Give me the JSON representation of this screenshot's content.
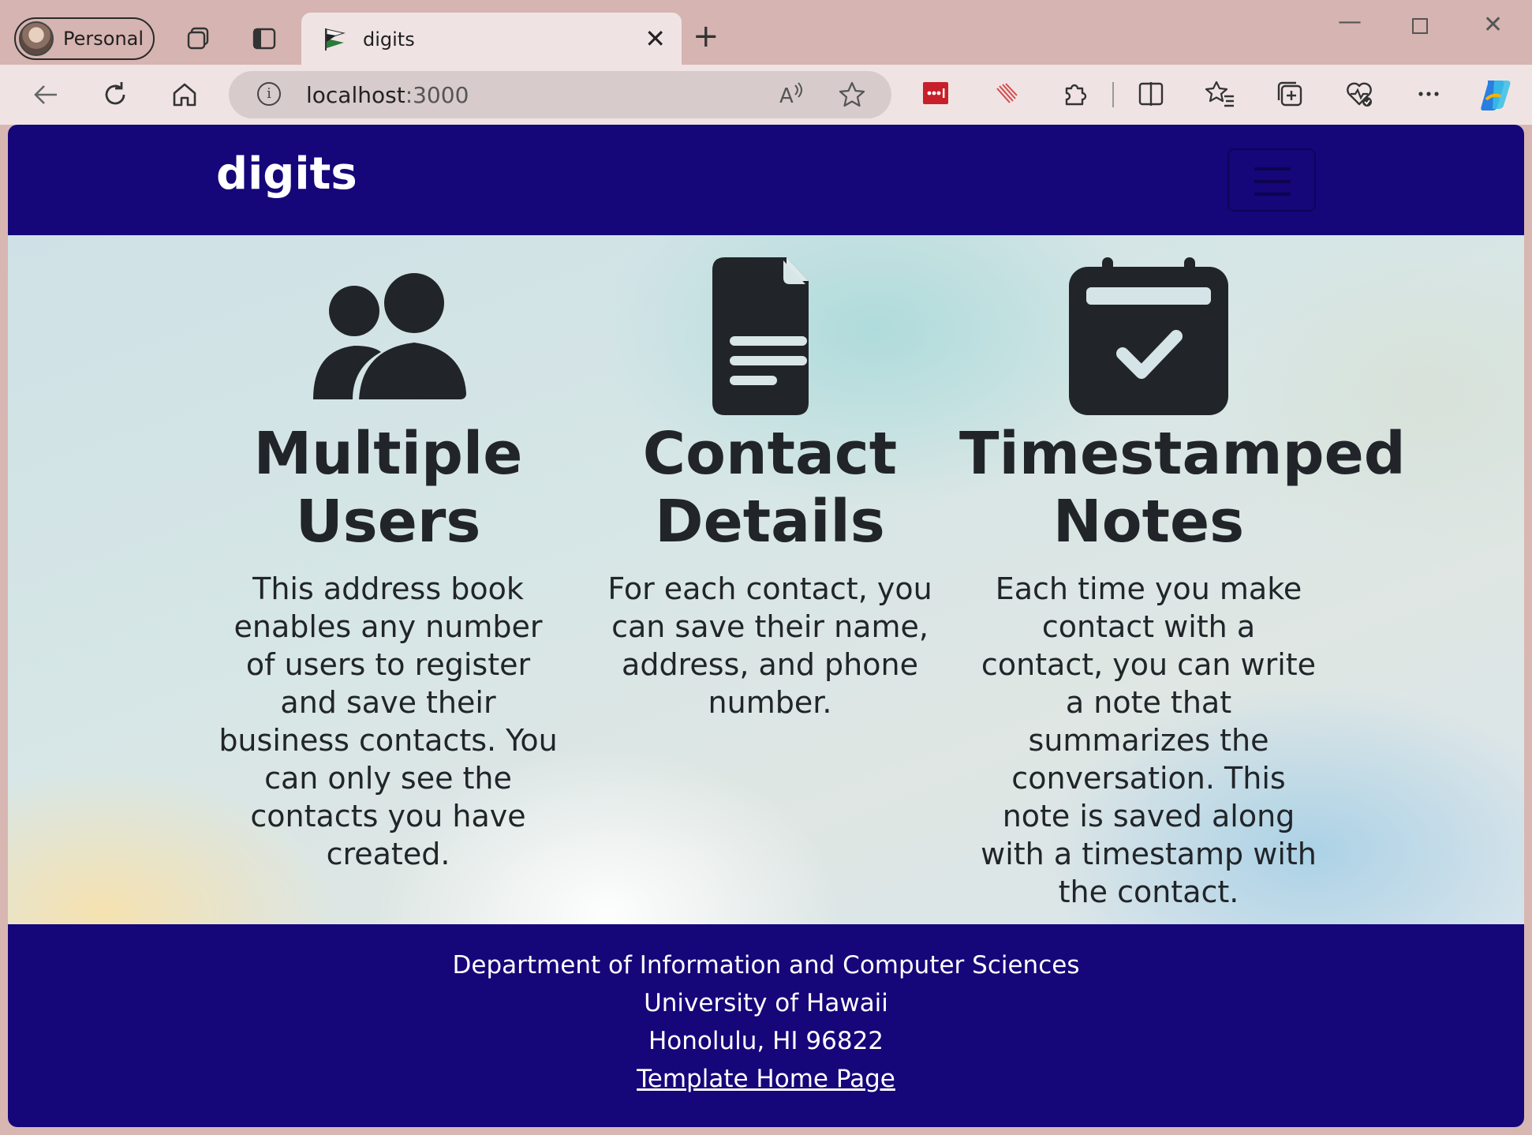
{
  "browser": {
    "profile_label": "Personal",
    "tab_title": "digits",
    "url_host": "localhost",
    "url_port": ":3000",
    "icons": [
      "workspaces-icon",
      "tab-actions-icon",
      "close-icon",
      "new-tab-icon",
      "back-icon",
      "refresh-icon",
      "home-icon",
      "info-icon",
      "read-aloud-icon",
      "favorite-star-icon",
      "lastpass-icon",
      "extension-icon",
      "puzzle-icon",
      "split-screen-icon",
      "favorites-icon",
      "collections-icon",
      "browser-essentials-icon",
      "more-icon",
      "copilot-icon"
    ]
  },
  "navbar": {
    "brand": "digits"
  },
  "features": [
    {
      "icon": "users-icon",
      "title_line1": "Multiple",
      "title_line2": "Users",
      "text": "This address book enables any number of users to register and save their business contacts. You can only see the contacts you have created."
    },
    {
      "icon": "file-text-icon",
      "title_line1": "Contact",
      "title_line2": "Details",
      "text": "For each contact, you can save their name, address, and phone number."
    },
    {
      "icon": "calendar-check-icon",
      "title_line1": "Timestamped",
      "title_line2": "Notes",
      "text": "Each time you make contact with a contact, you can write a note that summarizes the conversation. This note is saved along with a timestamp with the contact."
    }
  ],
  "footer": {
    "line1": "Department of Information and Computer Sciences",
    "line2": "University of Hawaii",
    "line3": "Honolulu, HI 96822",
    "link": "Template Home Page"
  },
  "colors": {
    "navbar_bg": "#15067a",
    "text_dark": "#212529"
  }
}
